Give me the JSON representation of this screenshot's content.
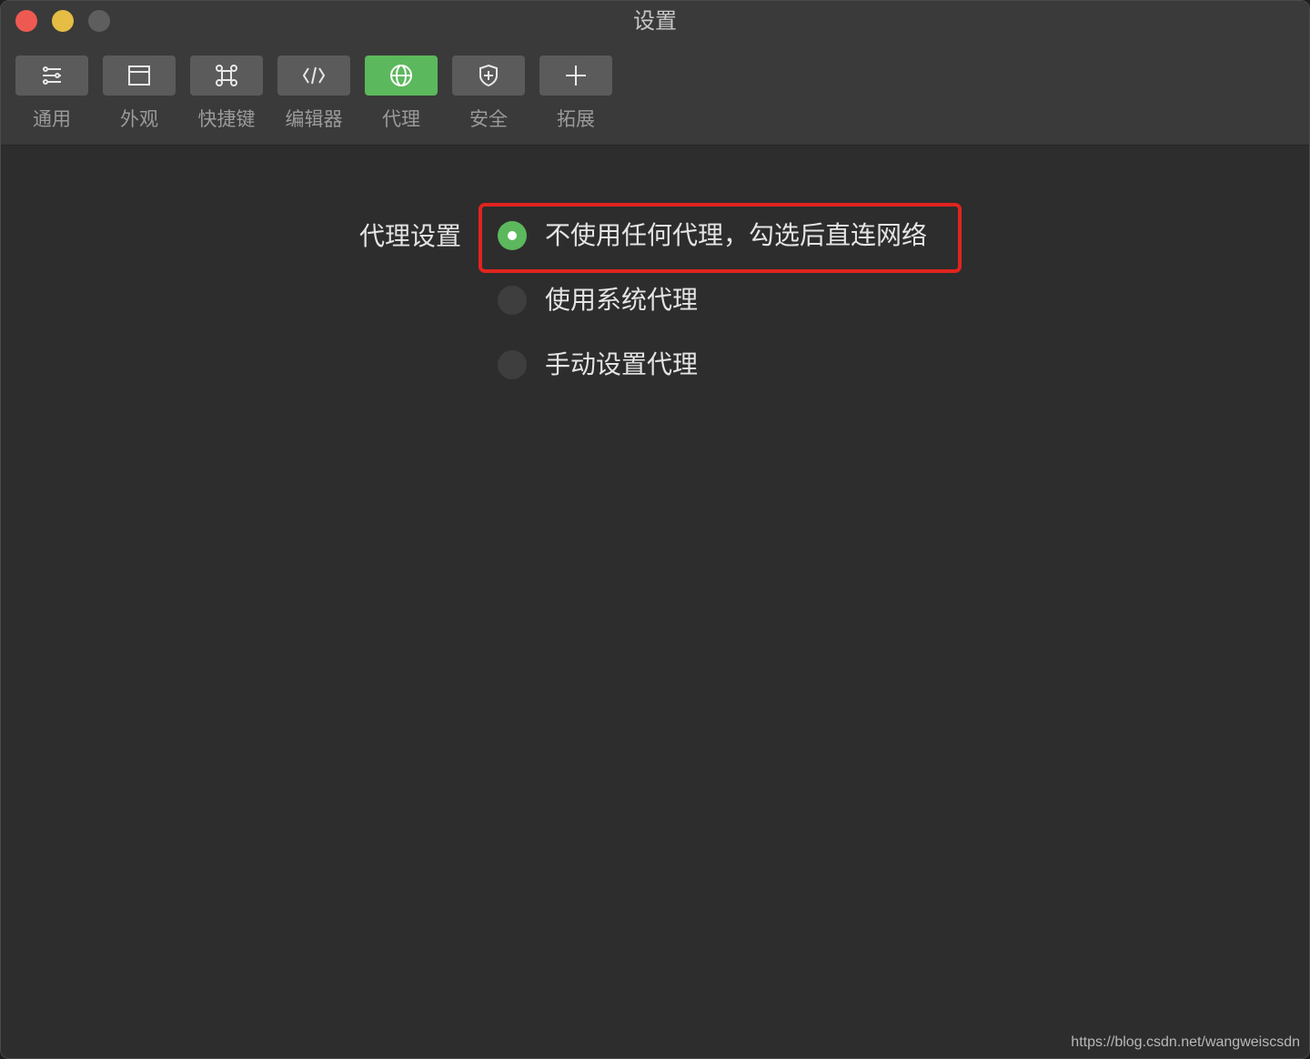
{
  "window": {
    "title": "设置"
  },
  "toolbar": {
    "items": [
      {
        "label": "通用",
        "icon": "sliders-icon",
        "active": false
      },
      {
        "label": "外观",
        "icon": "window-icon",
        "active": false
      },
      {
        "label": "快捷键",
        "icon": "command-icon",
        "active": false
      },
      {
        "label": "编辑器",
        "icon": "code-icon",
        "active": false
      },
      {
        "label": "代理",
        "icon": "globe-icon",
        "active": true
      },
      {
        "label": "安全",
        "icon": "shield-icon",
        "active": false
      },
      {
        "label": "拓展",
        "icon": "plus-icon",
        "active": false
      }
    ]
  },
  "proxy": {
    "section_label": "代理设置",
    "options": [
      {
        "label": "不使用任何代理，勾选后直连网络",
        "selected": true
      },
      {
        "label": "使用系统代理",
        "selected": false
      },
      {
        "label": "手动设置代理",
        "selected": false
      }
    ]
  },
  "colors": {
    "accent": "#5cb85c",
    "highlight": "#e0241f",
    "background": "#2d2d2d",
    "toolbar": "#3a3a3a"
  },
  "watermark": "https://blog.csdn.net/wangweiscsdn"
}
